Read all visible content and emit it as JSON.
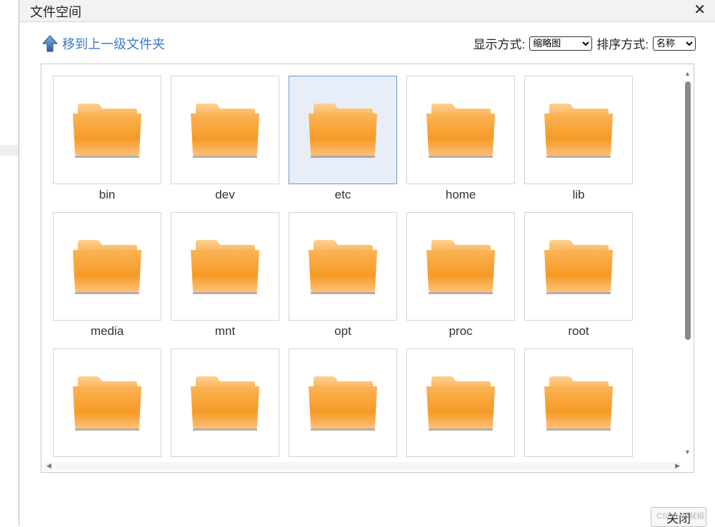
{
  "dialog": {
    "title": "文件空间",
    "close_symbol": "✕"
  },
  "toolbar": {
    "up_label": "移到上一级文件夹",
    "view_label": "显示方式:",
    "view_value": "缩略图",
    "sort_label": "排序方式:",
    "sort_value": "名称"
  },
  "folders": [
    {
      "name": "bin",
      "selected": false
    },
    {
      "name": "dev",
      "selected": false
    },
    {
      "name": "etc",
      "selected": true
    },
    {
      "name": "home",
      "selected": false
    },
    {
      "name": "lib",
      "selected": false
    },
    {
      "name": "media",
      "selected": false
    },
    {
      "name": "mnt",
      "selected": false
    },
    {
      "name": "opt",
      "selected": false
    },
    {
      "name": "proc",
      "selected": false
    },
    {
      "name": "root",
      "selected": false
    },
    {
      "name": "",
      "selected": false
    },
    {
      "name": "",
      "selected": false
    },
    {
      "name": "",
      "selected": false
    },
    {
      "name": "",
      "selected": false
    },
    {
      "name": "",
      "selected": false
    }
  ],
  "footer": {
    "close_button": "关闭",
    "watermark": "CSDN @就椒"
  },
  "colors": {
    "link": "#3b7bc8",
    "folder": "#f7a83a",
    "selected_bg": "#e8eef8"
  }
}
